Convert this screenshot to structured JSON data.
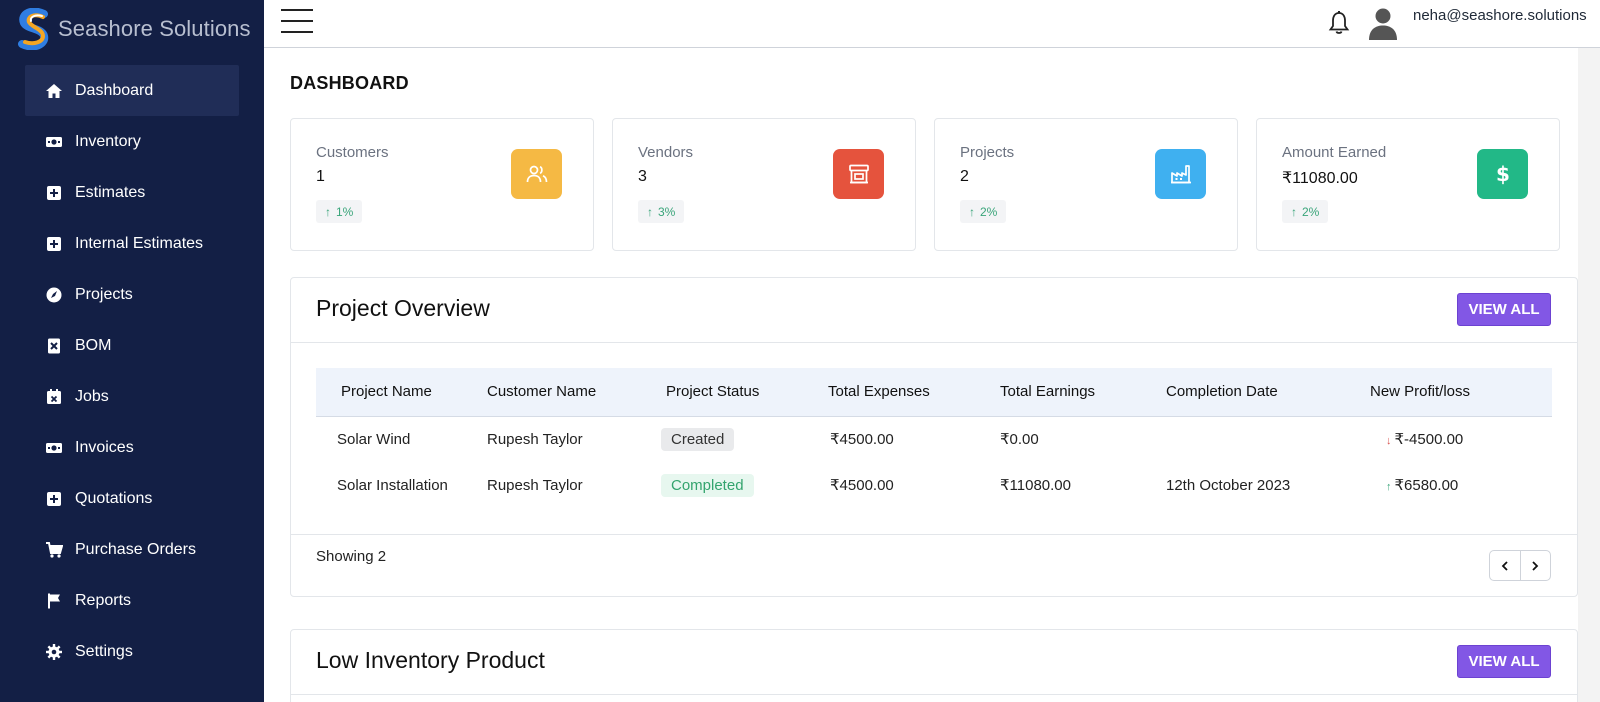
{
  "brand": {
    "name": "Seashore Solutions"
  },
  "sidebar": {
    "items": [
      {
        "label": "Dashboard",
        "icon": "home-icon",
        "active": true
      },
      {
        "label": "Inventory",
        "icon": "money-icon",
        "active": false
      },
      {
        "label": "Estimates",
        "icon": "plus-square-icon",
        "active": false
      },
      {
        "label": "Internal Estimates",
        "icon": "plus-square-icon",
        "active": false
      },
      {
        "label": "Projects",
        "icon": "compass-icon",
        "active": false
      },
      {
        "label": "BOM",
        "icon": "file-x-icon",
        "active": false
      },
      {
        "label": "Jobs",
        "icon": "calendar-x-icon",
        "active": false
      },
      {
        "label": "Invoices",
        "icon": "money-icon",
        "active": false
      },
      {
        "label": "Quotations",
        "icon": "plus-square-icon",
        "active": false
      },
      {
        "label": "Purchase Orders",
        "icon": "cart-icon",
        "active": false
      },
      {
        "label": "Reports",
        "icon": "flag-icon",
        "active": false
      },
      {
        "label": "Settings",
        "icon": "gear-icon",
        "active": false
      }
    ]
  },
  "topbar": {
    "user_email": "neha@seashore.solutions"
  },
  "page": {
    "title": "DASHBOARD"
  },
  "stats": [
    {
      "label": "Customers",
      "value": "1",
      "delta": "1%",
      "icon": "users-icon",
      "color": "#f5b944"
    },
    {
      "label": "Vendors",
      "value": "3",
      "delta": "3%",
      "icon": "store-icon",
      "color": "#e5533d"
    },
    {
      "label": "Projects",
      "value": "2",
      "delta": "2%",
      "icon": "factory-icon",
      "color": "#3fb0f0"
    },
    {
      "label": "Amount Earned",
      "value": "₹11080.00",
      "delta": "2%",
      "icon": "dollar-icon",
      "color": "#22b887"
    }
  ],
  "project_overview": {
    "title": "Project Overview",
    "view_all_label": "VIEW ALL",
    "columns": [
      "Project Name",
      "Customer Name",
      "Project Status",
      "Total Expenses",
      "Total Earnings",
      "Completion Date",
      "New Profit/loss"
    ],
    "rows": [
      {
        "name": "Solar Wind",
        "customer": "Rupesh Taylor",
        "status": "Created",
        "expenses": "₹4500.00",
        "earnings": "₹0.00",
        "date": "",
        "profit": "₹-4500.00",
        "trend": "down"
      },
      {
        "name": "Solar Installation",
        "customer": "Rupesh Taylor",
        "status": "Completed",
        "expenses": "₹4500.00",
        "earnings": "₹11080.00",
        "date": "12th October 2023",
        "profit": "₹6580.00",
        "trend": "up"
      }
    ],
    "showing": "Showing 2"
  },
  "low_inventory": {
    "title": "Low Inventory Product",
    "view_all_label": "VIEW ALL"
  },
  "colors": {
    "sidebar_bg": "#131f45",
    "sidebar_active": "#202d57",
    "accent": "#8257e5",
    "positive": "#3aa57a",
    "negative": "#d9534f"
  }
}
